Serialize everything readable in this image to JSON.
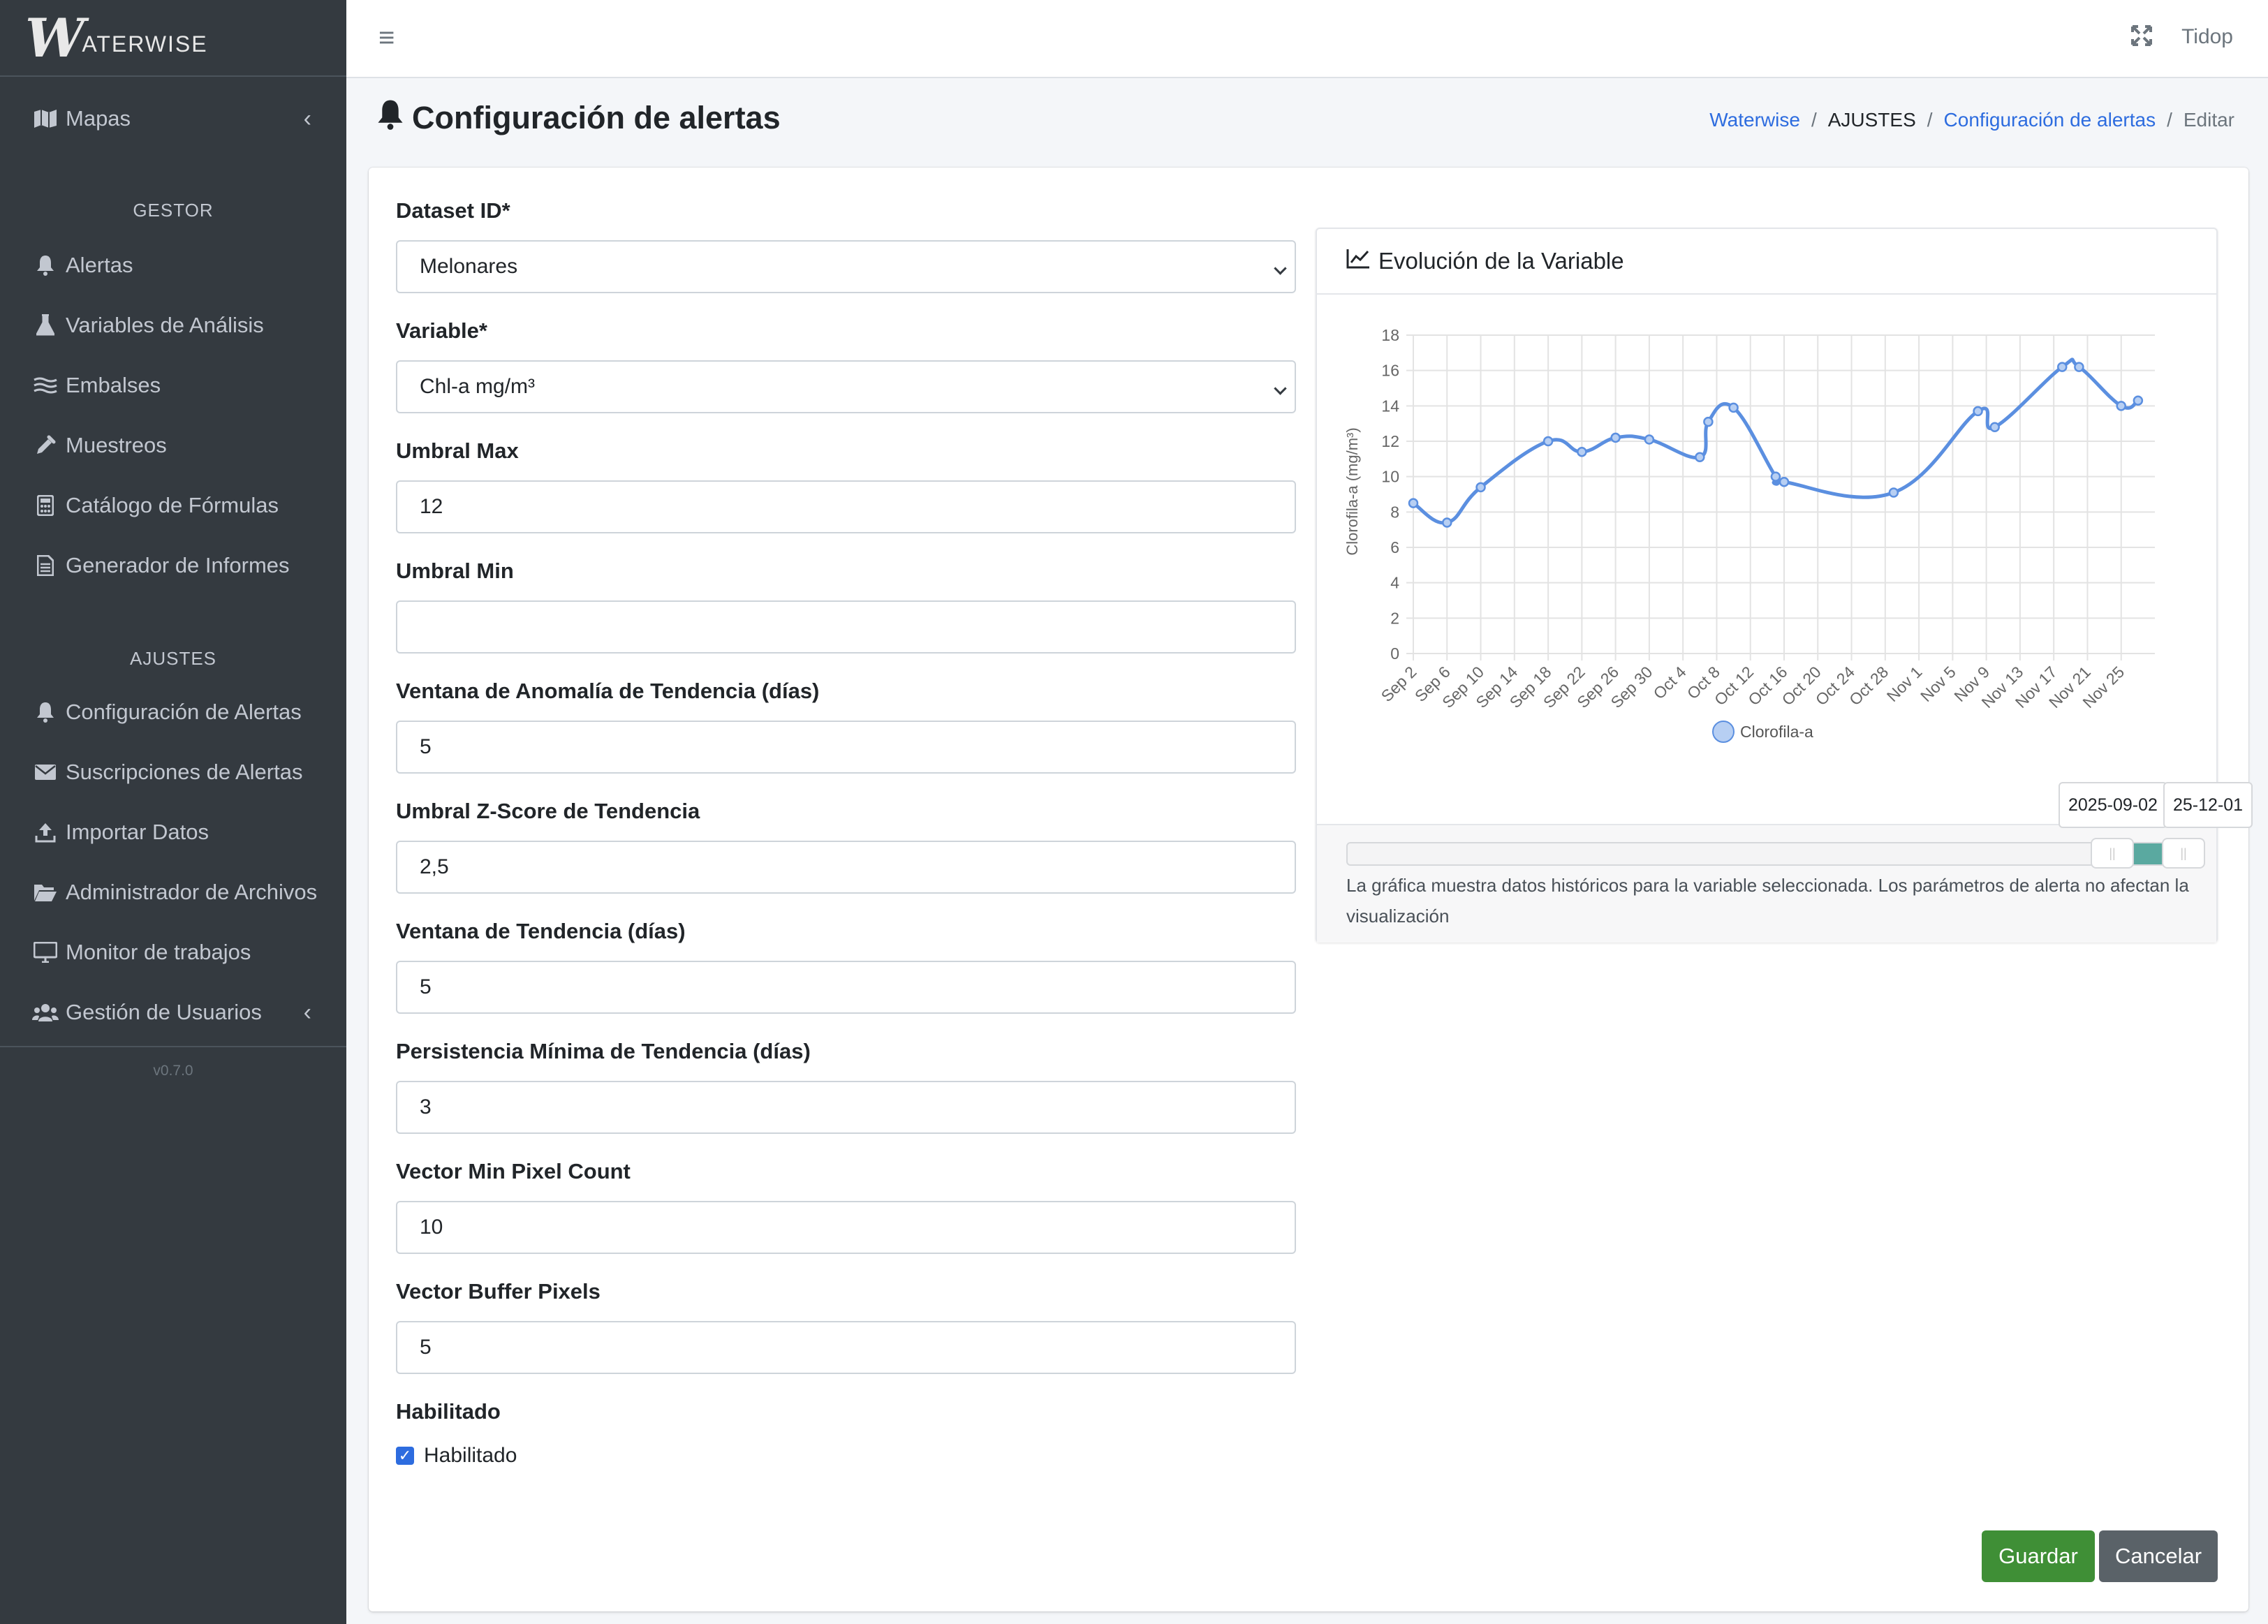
{
  "brand": {
    "logo": "W",
    "name": "ATERWISE"
  },
  "sidebar": {
    "mapas": "Mapas",
    "gestor_header": "GESTOR",
    "gestor_items": [
      {
        "label": "Alertas",
        "icon": "bell-icon"
      },
      {
        "label": "Variables de Análisis",
        "icon": "flask-icon"
      },
      {
        "label": "Embalses",
        "icon": "water-icon"
      },
      {
        "label": "Muestreos",
        "icon": "eyedropper-icon"
      },
      {
        "label": "Catálogo de Fórmulas",
        "icon": "calculator-icon"
      },
      {
        "label": "Generador de Informes",
        "icon": "report-icon"
      }
    ],
    "ajustes_header": "AJUSTES",
    "ajustes_items": [
      {
        "label": "Configuración de Alertas",
        "icon": "bell-icon"
      },
      {
        "label": "Suscripciones de Alertas",
        "icon": "envelope-icon"
      },
      {
        "label": "Importar Datos",
        "icon": "upload-icon"
      },
      {
        "label": "Administrador de Archivos",
        "icon": "folder-icon"
      },
      {
        "label": "Monitor de trabajos",
        "icon": "desktop-icon"
      },
      {
        "label": "Gestión de Usuarios",
        "icon": "users-icon"
      }
    ],
    "version": "v0.7.0"
  },
  "topbar": {
    "user": "Tidop"
  },
  "page": {
    "title": "Configuración de alertas",
    "breadcrumb": [
      "Waterwise",
      "AJUSTES",
      "Configuración de alertas",
      "Editar"
    ]
  },
  "form": {
    "dataset_label": "Dataset ID*",
    "dataset_value": "Melonares",
    "variable_label": "Variable*",
    "variable_value": "Chl-a mg/m³",
    "umbral_max_label": "Umbral Max",
    "umbral_max_value": "12",
    "umbral_min_label": "Umbral Min",
    "umbral_min_value": "",
    "ventana_anomalia_label": "Ventana de Anomalía de Tendencia (días)",
    "ventana_anomalia_value": "5",
    "zscore_label": "Umbral Z-Score de Tendencia",
    "zscore_value": "2,5",
    "ventana_tendencia_label": "Ventana de Tendencia (días)",
    "ventana_tendencia_value": "5",
    "persistencia_label": "Persistencia Mínima de Tendencia (días)",
    "persistencia_value": "3",
    "vector_min_label": "Vector Min Pixel Count",
    "vector_min_value": "10",
    "vector_buffer_label": "Vector Buffer Pixels",
    "vector_buffer_value": "5",
    "habilitado_label": "Habilitado",
    "habilitado_checkbox_label": "Habilitado",
    "habilitado_checked": true,
    "save": "Guardar",
    "cancel": "Cancelar"
  },
  "chart_panel": {
    "title": "Evolución de la Variable",
    "note": "La gráfica muestra datos históricos para la variable seleccionada. Los parámetros de alerta no afectan la visualización",
    "range_start": "2025-09-02",
    "range_end": "25-12-01"
  },
  "chart_data": {
    "type": "line",
    "ylabel": "Clorofila-a (mg/m³)",
    "ylim": [
      0,
      18
    ],
    "yticks": [
      0,
      2,
      4,
      6,
      8,
      10,
      12,
      14,
      16,
      18
    ],
    "xticks": [
      "Sep 2",
      "Sep 6",
      "Sep 10",
      "Sep 14",
      "Sep 18",
      "Sep 22",
      "Sep 26",
      "Sep 30",
      "Oct 4",
      "Oct 8",
      "Oct 12",
      "Oct 16",
      "Oct 20",
      "Oct 24",
      "Oct 28",
      "Nov 1",
      "Nov 5",
      "Nov 9",
      "Nov 13",
      "Nov 17",
      "Nov 21",
      "Nov 25"
    ],
    "grid": true,
    "legend": "bottom",
    "color": "#5b8fe0",
    "series": [
      {
        "name": "Clorofila-a",
        "x": [
          "2025-09-02",
          "2025-09-06",
          "2025-09-10",
          "2025-09-18",
          "2025-09-22",
          "2025-09-26",
          "2025-09-30",
          "2025-10-06",
          "2025-10-07",
          "2025-10-10",
          "2025-10-15",
          "2025-10-16",
          "2025-10-29",
          "2025-11-08",
          "2025-11-10",
          "2025-11-18",
          "2025-11-20",
          "2025-11-25",
          "2025-11-27"
        ],
        "values": [
          8.5,
          7.4,
          9.4,
          12.0,
          11.4,
          12.2,
          12.1,
          11.1,
          13.1,
          13.9,
          10.0,
          9.7,
          9.1,
          13.7,
          12.8,
          16.2,
          16.2,
          14.0,
          14.3
        ]
      }
    ]
  }
}
